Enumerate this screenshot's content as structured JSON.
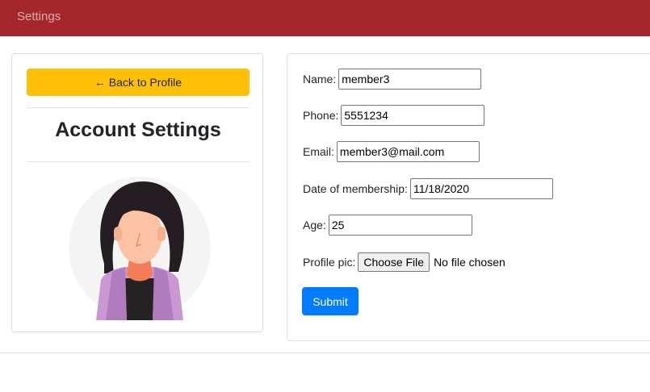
{
  "navbar": {
    "brand": "Settings"
  },
  "left_card": {
    "back_label": "← Back to Profile",
    "title": "Account Settings"
  },
  "form": {
    "name_label": "Name:",
    "name_value": "member3",
    "phone_label": "Phone:",
    "phone_value": "5551234",
    "email_label": "Email:",
    "email_value": "member3@mail.com",
    "date_label": "Date of membership:",
    "date_value": "11/18/2020",
    "age_label": "Age:",
    "age_value": "25",
    "pic_label": "Profile pic:",
    "choose_file_label": "Choose File",
    "file_status": "No file chosen",
    "submit_label": "Submit"
  },
  "colors": {
    "navbar": "#a4282b",
    "back_button": "#ffc107",
    "submit_button": "#007bff"
  },
  "icons": {
    "avatar": "woman-avatar-illustration"
  }
}
